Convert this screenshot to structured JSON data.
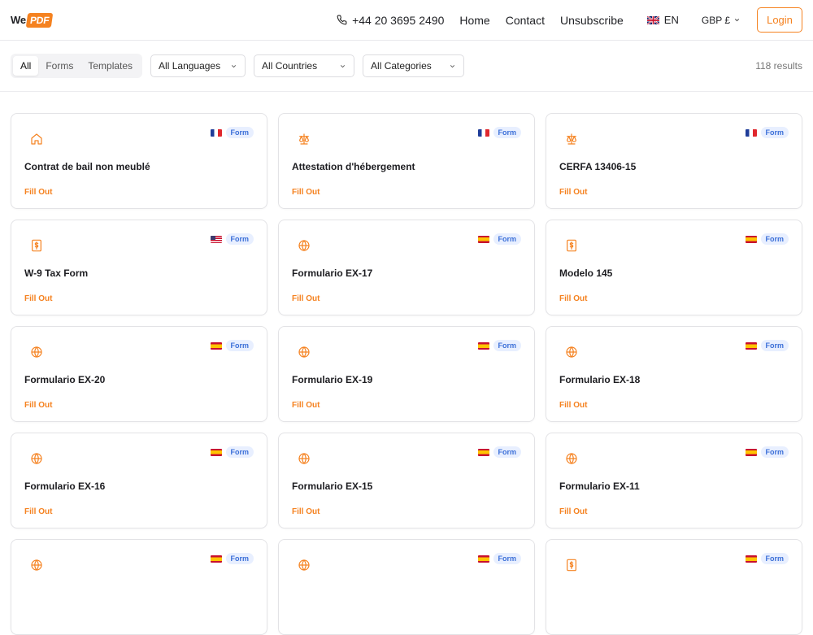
{
  "brand": {
    "we": "We",
    "pdf": "PDF",
    "accent": "#f58220"
  },
  "header": {
    "phone": "+44 20 3695 2490",
    "nav": [
      "Home",
      "Contact",
      "Unsubscribe"
    ],
    "language": "EN",
    "currency": "GBP £",
    "login": "Login"
  },
  "filters": {
    "tabs": [
      "All",
      "Forms",
      "Templates"
    ],
    "active_tab": "All",
    "selects": [
      "All Languages",
      "All Countries",
      "All Categories"
    ],
    "results": "118 results"
  },
  "cards": [
    {
      "title": "Contrat de bail non meublé",
      "icon": "home-icon",
      "flag": "fr",
      "badge": "Form",
      "action": "Fill Out"
    },
    {
      "title": "Attestation d'hébergement",
      "icon": "scale-icon",
      "flag": "fr",
      "badge": "Form",
      "action": "Fill Out"
    },
    {
      "title": "CERFA 13406-15",
      "icon": "scale-icon",
      "flag": "fr",
      "badge": "Form",
      "action": "Fill Out"
    },
    {
      "title": "W-9 Tax Form",
      "icon": "dollar-doc-icon",
      "flag": "us",
      "badge": "Form",
      "action": "Fill Out"
    },
    {
      "title": "Formulario EX-17",
      "icon": "globe-icon",
      "flag": "es",
      "badge": "Form",
      "action": "Fill Out"
    },
    {
      "title": "Modelo 145",
      "icon": "dollar-doc-icon",
      "flag": "es",
      "badge": "Form",
      "action": "Fill Out"
    },
    {
      "title": "Formulario EX-20",
      "icon": "globe-icon",
      "flag": "es",
      "badge": "Form",
      "action": "Fill Out"
    },
    {
      "title": "Formulario EX-19",
      "icon": "globe-icon",
      "flag": "es",
      "badge": "Form",
      "action": "Fill Out"
    },
    {
      "title": "Formulario EX-18",
      "icon": "globe-icon",
      "flag": "es",
      "badge": "Form",
      "action": "Fill Out"
    },
    {
      "title": "Formulario EX-16",
      "icon": "globe-icon",
      "flag": "es",
      "badge": "Form",
      "action": "Fill Out"
    },
    {
      "title": "Formulario EX-15",
      "icon": "globe-icon",
      "flag": "es",
      "badge": "Form",
      "action": "Fill Out"
    },
    {
      "title": "Formulario EX-11",
      "icon": "globe-icon",
      "flag": "es",
      "badge": "Form",
      "action": "Fill Out"
    },
    {
      "title": "",
      "icon": "globe-icon",
      "flag": "es",
      "badge": "Form",
      "action": ""
    },
    {
      "title": "",
      "icon": "globe-icon",
      "flag": "es",
      "badge": "Form",
      "action": ""
    },
    {
      "title": "",
      "icon": "dollar-doc-icon",
      "flag": "es",
      "badge": "Form",
      "action": ""
    }
  ]
}
